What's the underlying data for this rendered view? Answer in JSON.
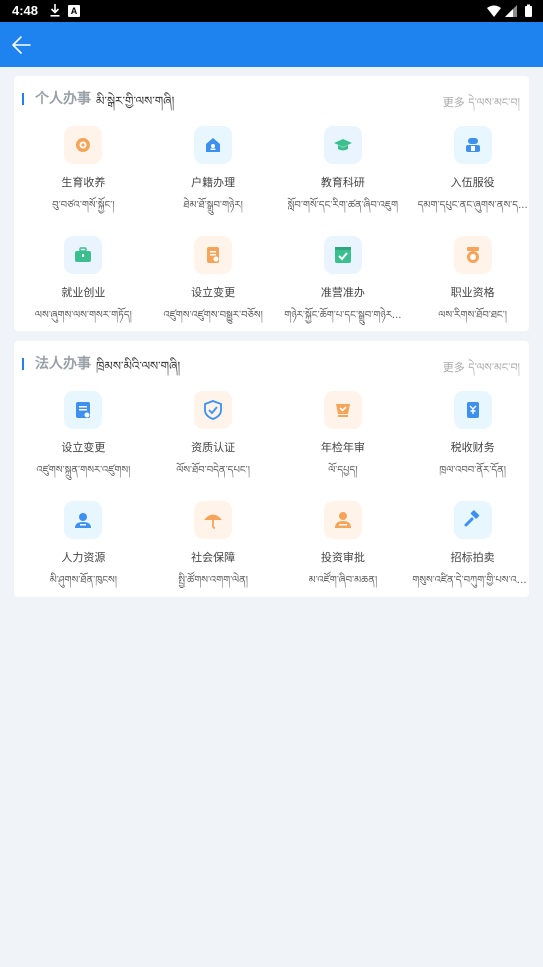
{
  "status_bar": {
    "time": "4:48",
    "a_badge": "A"
  },
  "personal": {
    "title": "个人办事",
    "title_bo": "མི་སྒེར་གྱི་ལས་གཞི།",
    "more": "更多 དེ་ལས་མང་བ།",
    "items": [
      {
        "label": "生育收养",
        "label_bo": "བུ་བཙའ་གསོ་སྐྱོང་།",
        "icon": "baby-icon"
      },
      {
        "label": "户籍办理",
        "label_bo": "ཐེམ་ཐོ་སྒྲུབ་གཉེར།",
        "icon": "house-icon"
      },
      {
        "label": "教育科研",
        "label_bo": "སློབ་གསོ་དང་རིག་ཚན་ཞིབ་འཇུག",
        "icon": "graduation-cap-icon"
      },
      {
        "label": "入伍服役",
        "label_bo": "དམག་དཔུང་ནང་ཞུགས་ནས་ད...",
        "icon": "soldier-icon"
      },
      {
        "label": "就业创业",
        "label_bo": "ལས་ཞུགས་ལས་གསར་གཏོད།",
        "icon": "briefcase-icon"
      },
      {
        "label": "设立变更",
        "label_bo": "འཛུགས་འཛུགས་བསྒྱུར་བཅོས།",
        "icon": "document-icon"
      },
      {
        "label": "准营准办",
        "label_bo": "གཉེར་སྐྱོང་ཆོག་པ་དང་སྒྲུབ་གཉེར...",
        "icon": "checkbox-icon"
      },
      {
        "label": "职业资格",
        "label_bo": "ལས་རིགས་ཐོབ་ཐང་།",
        "icon": "medal-icon"
      }
    ]
  },
  "legal": {
    "title": "法人办事",
    "title_bo": "ཁྲིམས་མིའི་ལས་གཞི།",
    "more": "更多 དེ་ལས་མང་བ།",
    "items": [
      {
        "label": "设立变更",
        "label_bo": "འཛུགས་སྐྲུན་གསར་འཛུགས།",
        "icon": "form-icon"
      },
      {
        "label": "资质认证",
        "label_bo": "ལོས་ཐོབ་བདེན་དཔང་།",
        "icon": "shield-check-icon"
      },
      {
        "label": "年检年审",
        "label_bo": "ལོ་དཔྱད།",
        "icon": "annual-review-icon"
      },
      {
        "label": "税收财务",
        "label_bo": "ཁྲལ་འབབ་ནོར་དོན།",
        "icon": "tax-icon"
      },
      {
        "label": "人力资源",
        "label_bo": "མི་ཤུགས་ཐོན་ཁུངས།",
        "icon": "people-icon"
      },
      {
        "label": "社会保障",
        "label_bo": "སྤྱི་ཚོགས་འགག་ལེན།",
        "icon": "umbrella-icon"
      },
      {
        "label": "投资审批",
        "label_bo": "མ་འཛོག་ཞིབ་མཆན།",
        "icon": "investor-icon"
      },
      {
        "label": "招标拍卖",
        "label_bo": "གསུས་འཛིན་དེ་བཀུག་གྱི་པས་འཚོང་།",
        "icon": "gavel-icon"
      }
    ]
  },
  "colors": {
    "appbar": "#1e82ef",
    "accent_orange": "#f5a45a",
    "accent_blue": "#3d8ff0",
    "accent_green": "#3cbf8f"
  }
}
